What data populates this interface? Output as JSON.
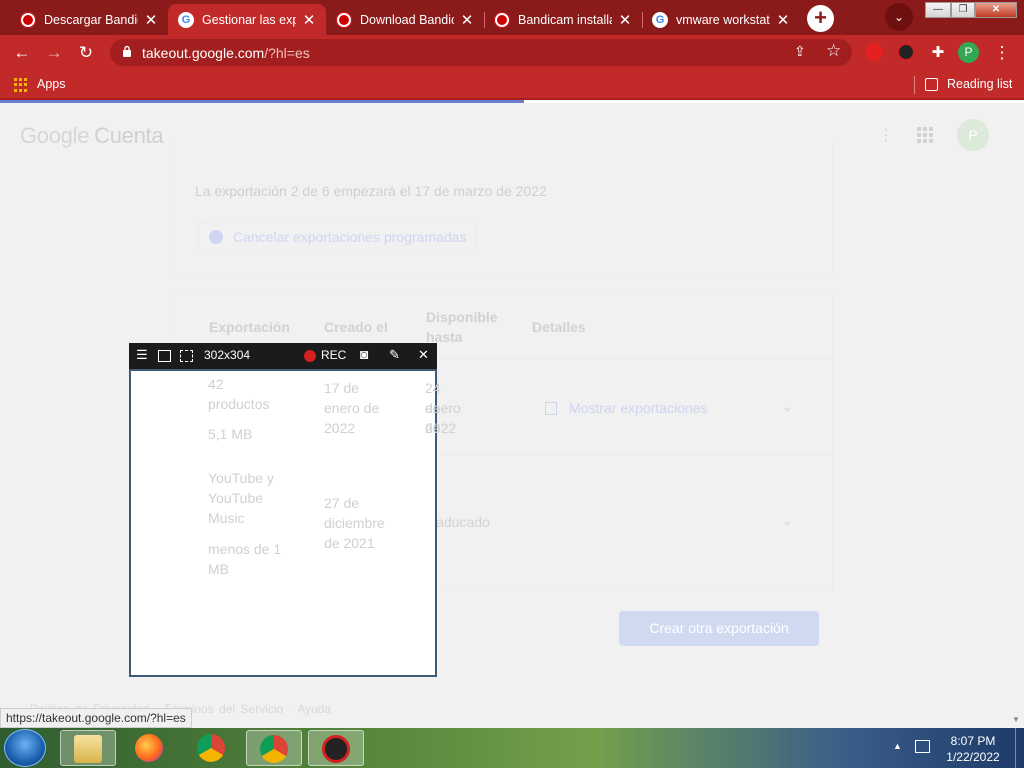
{
  "tabs": [
    {
      "title": "Descargar Bandic",
      "favicon": "bandicam-icon",
      "active": false
    },
    {
      "title": "Gestionar las exp",
      "favicon": "google-icon",
      "active": true
    },
    {
      "title": "Download Bandic",
      "favicon": "bandicam-icon",
      "active": false
    },
    {
      "title": "Bandicam installa",
      "favicon": "bandicam-icon",
      "active": false
    },
    {
      "title": "vmware workstati",
      "favicon": "google-icon",
      "active": false
    }
  ],
  "toolbar": {
    "url_host": "takeout.google.com",
    "url_path": "/?hl=es",
    "profile_initial": "P"
  },
  "bookmarks": {
    "apps_label": "Apps",
    "reading_list_label": "Reading list"
  },
  "page": {
    "logo_google": "Google",
    "logo_cuenta": "Cuenta",
    "avatar_initial": "P",
    "schedule_text": "La exportación 2 de 6 empezará el 17 de marzo de 2022",
    "cancel_label": "Cancelar exportaciones programadas",
    "headers": {
      "export": "Exportación",
      "created": "Creado el",
      "available_1": "Disponible",
      "available_2": "hasta",
      "details": "Detalles"
    },
    "rows": [
      {
        "export_1": "42",
        "export_2": "productos",
        "size": "5,1 MB",
        "created_1": "17 de",
        "created_2": "enero de",
        "created_3": "2022",
        "avail_1": "24 de",
        "avail_2": "enero de",
        "avail_3": "2022",
        "details": "Mostrar exportaciones"
      },
      {
        "export_1": "YouTube y",
        "export_2": "YouTube",
        "export_3": "Music",
        "size_1": "menos de 1",
        "size_2": "MB",
        "created_1": "27 de",
        "created_2": "diciembre",
        "created_3": "de 2021",
        "avail": "Caducado"
      }
    ],
    "new_export_label": "Crear otra exportación",
    "footer": "Política de Privacidad · Términos del Servicio · Ayuda"
  },
  "bandicam": {
    "size": "302x304",
    "rec_label": "REC"
  },
  "status_url": "https://takeout.google.com/?hl=es",
  "taskbar": {
    "time": "8:07 PM",
    "date": "1/22/2022"
  },
  "colors": {
    "tab_strip": "#8b1a1a",
    "toolbar": "#c22a2a",
    "page_bg": "#f1f1f1",
    "rec_red": "#d42020"
  }
}
